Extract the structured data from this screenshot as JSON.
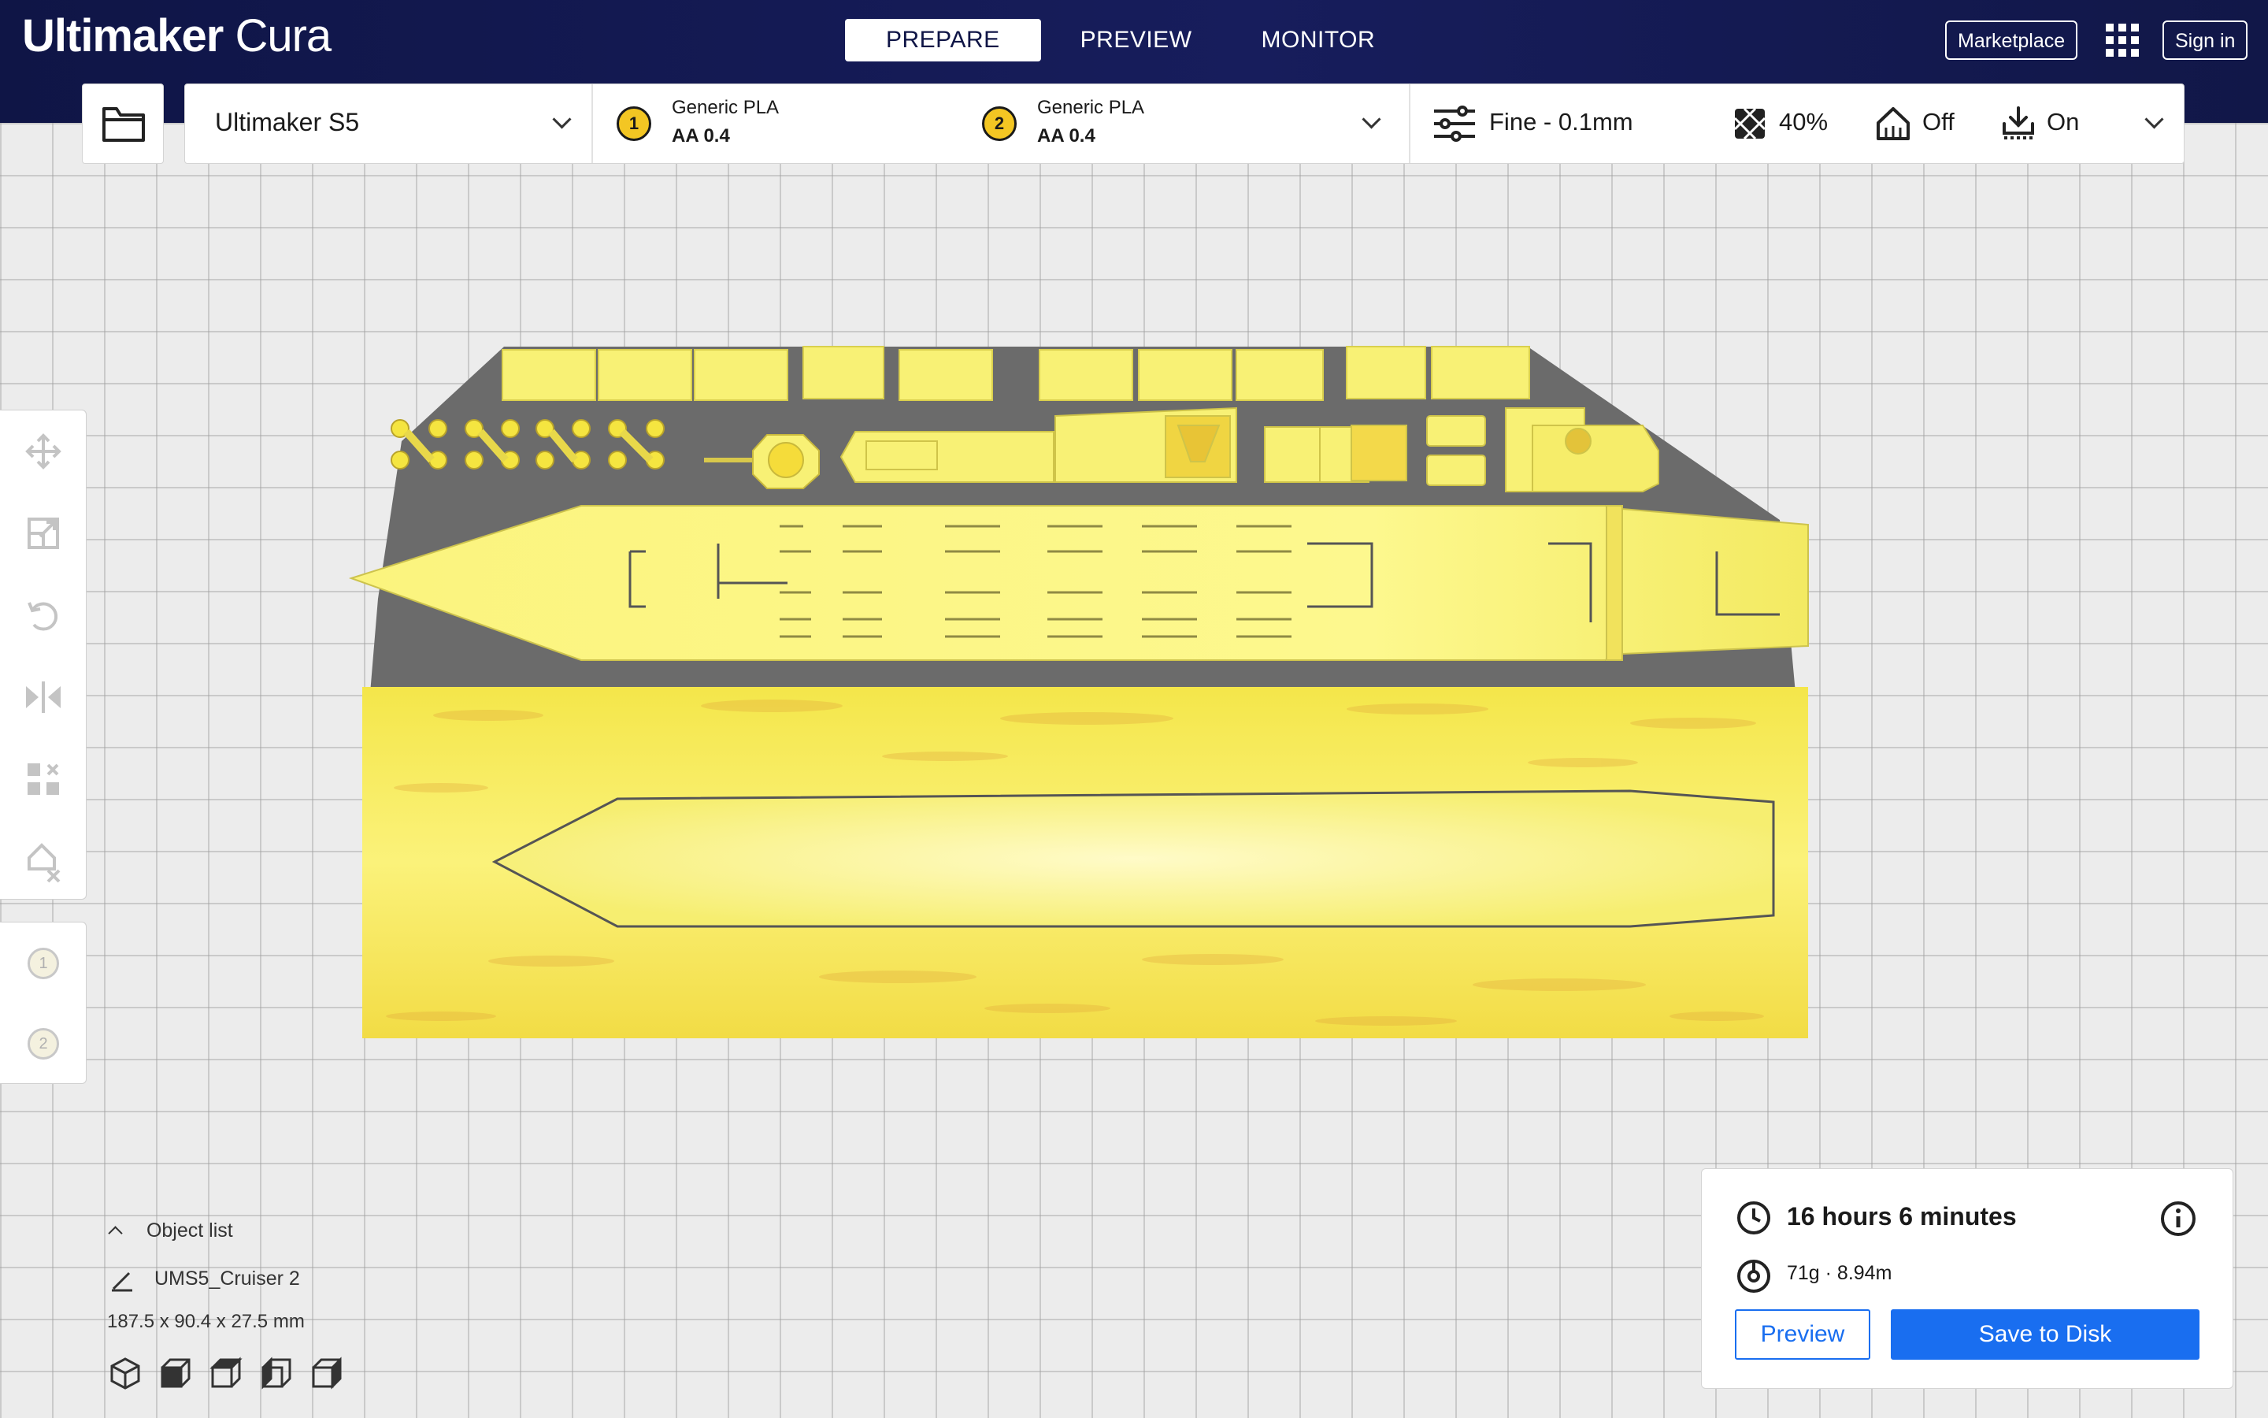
{
  "app": {
    "brand_bold": "Ultimaker",
    "brand_light": "Cura"
  },
  "stages": [
    {
      "label": "PREPARE",
      "active": true
    },
    {
      "label": "PREVIEW",
      "active": false
    },
    {
      "label": "MONITOR",
      "active": false
    }
  ],
  "header": {
    "marketplace_label": "Marketplace",
    "signin_label": "Sign in",
    "apps_icon": "grid-apps-icon"
  },
  "printer": {
    "name": "Ultimaker S5",
    "extruders": [
      {
        "number": "1",
        "material": "Generic PLA",
        "core": "AA 0.4",
        "color": "#f3c623"
      },
      {
        "number": "2",
        "material": "Generic PLA",
        "core": "AA 0.4",
        "color": "#f3c623"
      }
    ]
  },
  "print_settings": {
    "profile": "Fine - 0.1mm",
    "infill": "40%",
    "support": "Off",
    "adhesion": "On"
  },
  "tools": [
    "move-tool-icon",
    "scale-tool-icon",
    "rotate-tool-icon",
    "mirror-tool-icon",
    "per-model-settings-icon",
    "support-blocker-icon"
  ],
  "extruder_tools": [
    "1",
    "2"
  ],
  "object_list": {
    "toggle_label": "Object list",
    "object_name": "UMS5_Cruiser 2",
    "dimensions": "187.5 x 90.4 x 27.5 mm"
  },
  "view_buttons": [
    "3d-view-icon",
    "front-view-icon",
    "top-view-icon",
    "left-view-icon",
    "right-view-icon"
  ],
  "estimate": {
    "time": "16 hours 6 minutes",
    "material": "71g · 8.94m",
    "preview_label": "Preview",
    "save_label": "Save to Disk"
  },
  "colors": {
    "accent": "#196ef0",
    "header": "#171d5c",
    "model": "#f7f36e",
    "buildplate_shadow": "#6b6b6b"
  }
}
